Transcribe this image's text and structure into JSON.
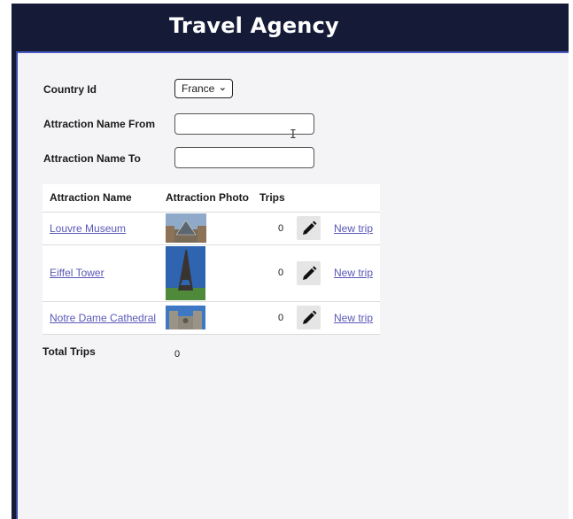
{
  "header": {
    "title": "Travel Agency"
  },
  "filters": {
    "country_label": "Country Id",
    "country_value": "France",
    "from_label": "Attraction Name From",
    "from_value": "",
    "to_label": "Attraction Name To",
    "to_value": ""
  },
  "grid": {
    "columns": [
      "Attraction Name",
      "Attraction Photo",
      "Trips"
    ],
    "rows": [
      {
        "name": "Louvre Museum",
        "trips": "0",
        "action": "New trip",
        "edit_icon": "pencil-icon"
      },
      {
        "name": "Eiffel Tower",
        "trips": "0",
        "action": "New trip",
        "edit_icon": "pencil-icon"
      },
      {
        "name": "Notre Dame Cathedral",
        "trips": "0",
        "action": "New trip",
        "edit_icon": "pencil-icon"
      }
    ]
  },
  "totals": {
    "label": "Total Trips",
    "value": "0"
  },
  "colors": {
    "header_bg": "#151b37",
    "link": "#5a58b8",
    "content_bg": "#f4f4f6"
  }
}
